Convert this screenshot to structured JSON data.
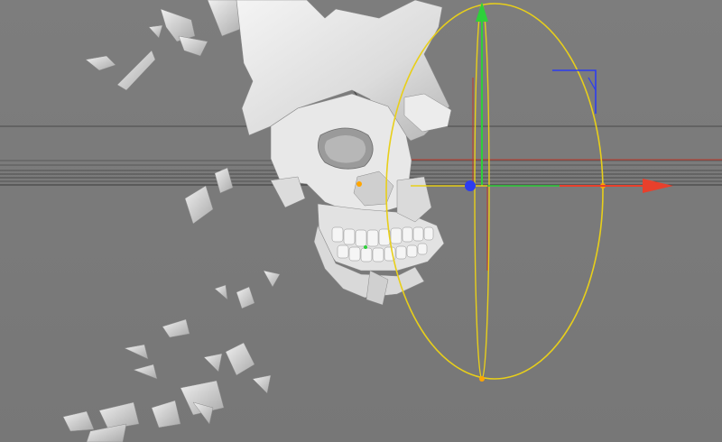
{
  "viewport": {
    "background_color": "#7b7b7b",
    "mode": "3d-perspective"
  },
  "scene": {
    "object": {
      "icon": "skull-mesh-icon",
      "surface_color": "#e4e4e4",
      "shadow_color": "#a8a8a8",
      "fragment_color": "#d9d9d9"
    }
  },
  "gizmo": {
    "colors": {
      "x_axis": "#e8402c",
      "y_axis": "#2ed03a",
      "z_axis": "#2d3df0",
      "rotation_ring": "#e8cf1a",
      "pivot_point": "#ffa500"
    },
    "axes": [
      {
        "name": "x-axis-arrow",
        "icon": "arrow-right-icon"
      },
      {
        "name": "y-axis-arrow",
        "icon": "arrow-up-icon"
      },
      {
        "name": "z-axis-pivot",
        "icon": "dot-icon"
      }
    ]
  }
}
